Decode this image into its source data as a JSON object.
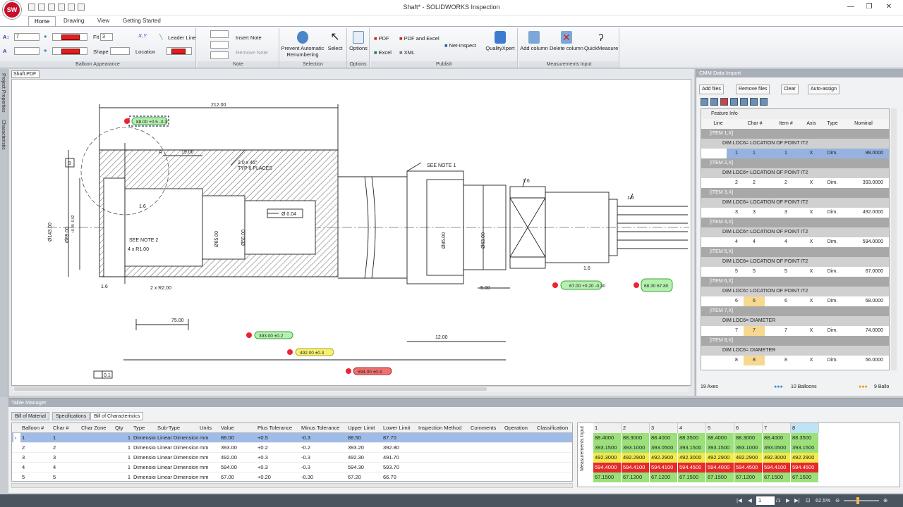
{
  "window": {
    "title": "Shaft* - SOLIDWORKS Inspection",
    "logo_text": "SW"
  },
  "ribbon_tabs": [
    "Home",
    "Drawing",
    "View",
    "Getting Started"
  ],
  "ribbon": {
    "balloon": {
      "font_size": "7",
      "fit_label": "Fit",
      "fit_value": "3",
      "shape_label": "Shape",
      "location_label": "Location",
      "leader_line_label": "Leader Line",
      "group_label": "Balloon Appearance",
      "xy_label": "X,Y"
    },
    "note": {
      "insert_label": "Insert Note",
      "remove_label": "Remove Note",
      "group_label": "Note"
    },
    "selection": {
      "prevent_label": "Prevent Automatic Renumbering",
      "select_label": "Select",
      "group_label": "Selection"
    },
    "options": {
      "label": "Options",
      "group_label": "Options"
    },
    "publish": {
      "pdf": "PDF",
      "pdf_excel": "PDF and Excel",
      "excel": "Excel",
      "xml": "XML",
      "net_inspect": "Net-Inspect",
      "qualityxpert": "QualityXpert",
      "group_label": "Publish"
    },
    "measurements": {
      "add_column": "Add column",
      "delete_column": "Delete column",
      "quickmeasure": "QuickMeasure",
      "group_label": "Measurements Input"
    }
  },
  "side_tabs": [
    "Project Properties",
    "Characteristic"
  ],
  "doc_tab": "Shaft.PDF",
  "drawing": {
    "dims": [
      "212.00",
      "19.00",
      "2.0 x 45°",
      "TYP 6 PLACES",
      "SEE NOTE 1",
      "SEE NOTE 2",
      "4 x R1.00",
      "2 x R2.00",
      "Ø143.00",
      "Ø89.00",
      "+0.00 -0.02",
      "Ø65.00",
      "Ø50.00",
      "Ø85.00",
      "Ø63.00",
      "Ø 0.04",
      "75.00",
      "12.00",
      "5.00",
      "1.6",
      "B",
      "A",
      "0.1"
    ],
    "balloons": [
      {
        "num": "1",
        "text": "88.00 +0.5 -0.3"
      },
      {
        "num": "2",
        "text": "393.00 ±0.2"
      },
      {
        "num": "3",
        "text": "492.00 ±0.3"
      },
      {
        "num": "4",
        "text": "594.00 ±0.3"
      },
      {
        "num": "5",
        "text": "67.00 +0.20 -0.30"
      },
      {
        "num": "6",
        "text": "68.30 67.80"
      }
    ]
  },
  "cmm": {
    "title": "CMM Data Import",
    "buttons": [
      "Add files",
      "Remove files",
      "Clear",
      "Auto-assign"
    ],
    "feature_info": "Feature Info",
    "columns": [
      "Line",
      "Char #",
      "Item #",
      "Axis",
      "Type",
      "Nominal"
    ],
    "items": [
      {
        "item": "[ITEM 1,X]",
        "dim": "DIM LOC6= LOCATION OF POINT IT2",
        "line": "1",
        "char": "1",
        "itemno": "1",
        "axis": "X",
        "type": "Dim.",
        "nominal": "88.0000"
      },
      {
        "item": "[ITEM 2,X]",
        "dim": "DIM LOC6= LOCATION OF POINT IT2",
        "line": "2",
        "char": "2",
        "itemno": "2",
        "axis": "X",
        "type": "Dim.",
        "nominal": "393.0000"
      },
      {
        "item": "[ITEM 3,X]",
        "dim": "DIM LOC6= LOCATION OF POINT IT2",
        "line": "3",
        "char": "3",
        "itemno": "3",
        "axis": "X",
        "type": "Dim.",
        "nominal": "492.0000"
      },
      {
        "item": "[ITEM 4,X]",
        "dim": "DIM LOC6= LOCATION OF POINT IT2",
        "line": "4",
        "char": "4",
        "itemno": "4",
        "axis": "X",
        "type": "Dim.",
        "nominal": "594.0000"
      },
      {
        "item": "[ITEM 5,X]",
        "dim": "DIM LOC6= LOCATION OF POINT IT2",
        "line": "5",
        "char": "5",
        "itemno": "5",
        "axis": "X",
        "type": "Dim.",
        "nominal": "67.0000"
      },
      {
        "item": "[ITEM 6,X]",
        "dim": "DIM LOC6= LOCATION OF POINT IT2",
        "line": "6",
        "char": "6",
        "itemno": "6",
        "axis": "X",
        "type": "Dim.",
        "nominal": "68.0000"
      },
      {
        "item": "[ITEM 7,X]",
        "dim": "DIM LOC6= DIAMETER",
        "line": "7",
        "char": "7",
        "itemno": "7",
        "axis": "X",
        "type": "Dim.",
        "nominal": "74.0000"
      },
      {
        "item": "[ITEM 8,X]",
        "dim": "DIM LOC6= DIAMETER",
        "line": "8",
        "char": "8",
        "itemno": "8",
        "axis": "X",
        "type": "Dim.",
        "nominal": "56.0000"
      }
    ],
    "footer": {
      "axes": "19 Axes",
      "balloons": "10 Balloons",
      "balloons_right": "9 Ballo"
    }
  },
  "table_manager": {
    "title": "Table Manager",
    "tabs": [
      "Bill of Material",
      "Specifications",
      "Bill of Characteristics"
    ],
    "columns": [
      "Balloon #",
      "Char #",
      "Char Zone",
      "Qty",
      "Type",
      "Sub-Type",
      "Units",
      "Value",
      "Plus Tolerance",
      "Minus Tolerance",
      "Upper Limit",
      "Lower Limit",
      "Inspection Method",
      "Comments",
      "Operation",
      "Classification"
    ],
    "rows": [
      [
        "1",
        "1",
        "",
        "1",
        "Dimension",
        "Linear Dimension",
        "mm",
        "88.00",
        "+0.5",
        "-0.3",
        "88.50",
        "87.70",
        "",
        "",
        "",
        ""
      ],
      [
        "2",
        "2",
        "",
        "1",
        "Dimension",
        "Linear Dimension",
        "mm",
        "393.00",
        "+0.2",
        "-0.2",
        "393.20",
        "392.80",
        "",
        "",
        "",
        ""
      ],
      [
        "3",
        "3",
        "",
        "1",
        "Dimension",
        "Linear Dimension",
        "mm",
        "492.00",
        "+0.3",
        "-0.3",
        "492.30",
        "491.70",
        "",
        "",
        "",
        ""
      ],
      [
        "4",
        "4",
        "",
        "1",
        "Dimension",
        "Linear Dimension",
        "mm",
        "594.00",
        "+0.3",
        "-0.3",
        "594.30",
        "593.70",
        "",
        "",
        "",
        ""
      ],
      [
        "5",
        "5",
        "",
        "1",
        "Dimension",
        "Linear Dimension",
        "mm",
        "67.00",
        "+0.20",
        "-0.30",
        "67.20",
        "66.70",
        "",
        "",
        "",
        ""
      ]
    ],
    "meas_label": "Measurements Input",
    "meas_headers": [
      "1",
      "2",
      "3",
      "4",
      "5",
      "6",
      "7",
      "8"
    ],
    "meas_rows": [
      {
        "color": "#9be07a",
        "values": [
          "88.4000",
          "88.3000",
          "88.4000",
          "88.3500",
          "88.4000",
          "88.3000",
          "88.4000",
          "88.3500"
        ]
      },
      {
        "color": "#9be07a",
        "values": [
          "393.1500",
          "393.1000",
          "393.0500",
          "393.1500",
          "393.1500",
          "393.1000",
          "393.0500",
          "393.1500"
        ]
      },
      {
        "color": "#f2e94a",
        "values": [
          "492.3000",
          "492.2900",
          "492.2900",
          "492.3000",
          "492.2900",
          "492.2900",
          "492.3000",
          "492.2900"
        ]
      },
      {
        "color": "#e52a2a",
        "values": [
          "594.4000",
          "594.4100",
          "594.4100",
          "594.4500",
          "594.4000",
          "594.4500",
          "594.4100",
          "594.4500"
        ]
      },
      {
        "color": "#9be07a",
        "values": [
          "67.1500",
          "67.1200",
          "67.1200",
          "67.1500",
          "67.1500",
          "67.1200",
          "67.1500",
          "67.1500"
        ]
      }
    ]
  },
  "status": {
    "page": "1",
    "of": "/1",
    "zoom": "62.5%"
  }
}
